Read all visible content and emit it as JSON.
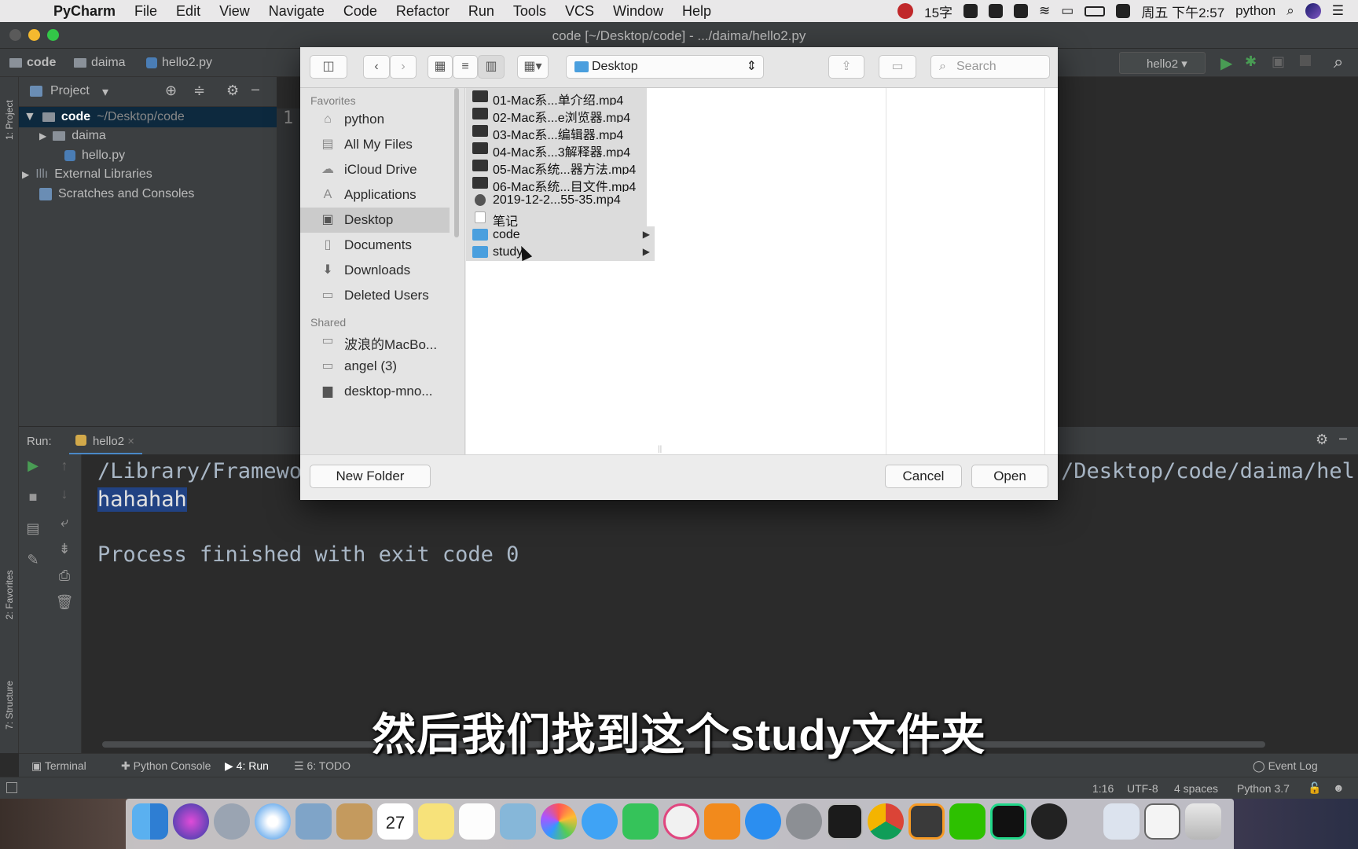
{
  "menubar": {
    "app": "PyCharm",
    "items": [
      "File",
      "Edit",
      "View",
      "Navigate",
      "Code",
      "Refactor",
      "Run",
      "Tools",
      "VCS",
      "Window",
      "Help"
    ],
    "status_count": "15字",
    "clock": "周五 下午2:57",
    "user": "python"
  },
  "window": {
    "title": "code [~/Desktop/code] - .../daima/hello2.py"
  },
  "navbar": {
    "crumbs": [
      "code",
      "daima",
      "hello2.py"
    ],
    "run_config": "hello2"
  },
  "project": {
    "header": "Project",
    "stripe_label": "1: Project",
    "tree": [
      {
        "label": "code",
        "path": "~/Desktop/code"
      },
      {
        "label": "daima"
      },
      {
        "label": "hello.py"
      },
      {
        "label": "External Libraries"
      },
      {
        "label": "Scratches and Consoles"
      }
    ]
  },
  "editor": {
    "line_number": "1"
  },
  "run": {
    "label": "Run:",
    "tab": "hello2",
    "console": {
      "path_left": "/Library/Framewo",
      "path_right": "/Desktop/code/daima/hel",
      "output": "hahahah",
      "finished": "Process finished with exit code 0"
    }
  },
  "left_stripe": {
    "favorites": "2: Favorites",
    "structure": "7: Structure"
  },
  "bottom_tabs": [
    "Terminal",
    "Python Console",
    "4: Run",
    "6: TODO"
  ],
  "event_log": "Event Log",
  "status": {
    "position": "1:16",
    "encoding": "UTF-8",
    "indent": "4 spaces",
    "interpreter": "Python 3.7"
  },
  "dock": {
    "calendar_day": "27"
  },
  "dialog": {
    "location": "Desktop",
    "search_placeholder": "Search",
    "favorites_header": "Favorites",
    "favorites": [
      {
        "label": "python",
        "icon": "home-icon"
      },
      {
        "label": "All My Files",
        "icon": "all-files-icon"
      },
      {
        "label": "iCloud Drive",
        "icon": "cloud-icon"
      },
      {
        "label": "Applications",
        "icon": "applications-icon"
      },
      {
        "label": "Desktop",
        "icon": "desktop-icon",
        "selected": true
      },
      {
        "label": "Documents",
        "icon": "documents-icon"
      },
      {
        "label": "Downloads",
        "icon": "downloads-icon"
      },
      {
        "label": "Deleted Users",
        "icon": "folder-icon"
      }
    ],
    "shared_header": "Shared",
    "shared": [
      {
        "label": "波浪的MacBo...",
        "icon": "computer-icon"
      },
      {
        "label": "angel (3)",
        "icon": "computer-icon"
      },
      {
        "label": "desktop-mno...",
        "icon": "pc-icon"
      }
    ],
    "files": [
      {
        "name": "01-Mac系...单介绍.mp4",
        "type": "video"
      },
      {
        "name": "02-Mac系...e浏览器.mp4",
        "type": "video"
      },
      {
        "name": "03-Mac系...编辑器.mp4",
        "type": "video"
      },
      {
        "name": "04-Mac系...3解释器.mp4",
        "type": "video"
      },
      {
        "name": "05-Mac系统...器方法.mp4",
        "type": "video"
      },
      {
        "name": "06-Mac系统...目文件.mp4",
        "type": "video"
      },
      {
        "name": "2019-12-2...55-35.mp4",
        "type": "video"
      },
      {
        "name": "笔记",
        "type": "document"
      },
      {
        "name": "code",
        "type": "folder"
      },
      {
        "name": "study",
        "type": "folder"
      }
    ],
    "new_folder": "New Folder",
    "cancel": "Cancel",
    "open": "Open"
  },
  "subtitle": "然后我们找到这个study文件夹",
  "colors": {
    "selection": "#214283",
    "accent_folder": "#4a9fde",
    "run_green": "#499c54"
  }
}
